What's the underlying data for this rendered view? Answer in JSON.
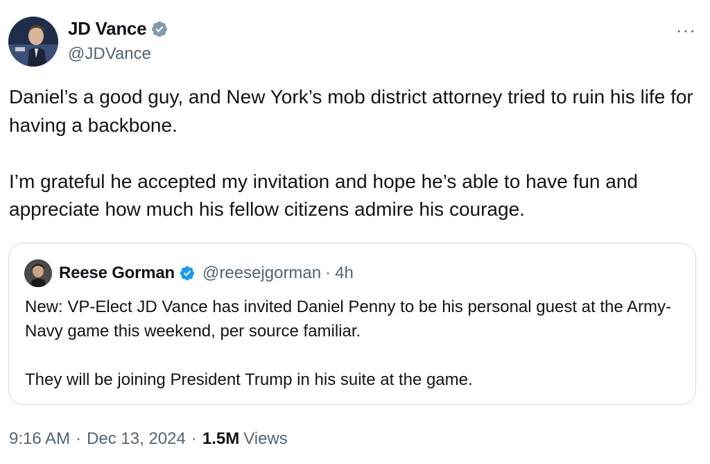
{
  "author": {
    "name": "JD Vance",
    "handle": "@JDVance"
  },
  "more_label": "···",
  "tweet": {
    "text": "Daniel’s a good guy, and New York’s mob district attorney tried to ruin his life for having a backbone.\n\nI’m grateful he accepted my invitation and hope he’s able to have fun and appreciate how much his fellow citizens admire his courage."
  },
  "quote": {
    "name": "Reese Gorman",
    "handle": "@reesejgorman",
    "dot": "·",
    "time": "4h",
    "text": "New: VP-Elect JD Vance has invited Daniel Penny to be his personal guest at the Army-Navy game this weekend, per source familiar.\n\nThey will be joining President Trump in his suite at the game."
  },
  "meta": {
    "time": "9:16 AM",
    "sep": "·",
    "date": "Dec 13, 2024",
    "views_count": "1.5M",
    "views_label": "Views"
  },
  "colors": {
    "badge_gray": "#829aab",
    "badge_blue": "#1d9bf0",
    "secondary_text": "#536471",
    "border": "#cfd9de"
  },
  "icons": {
    "author_badge": "verified-gray-badge-icon",
    "quote_badge": "verified-blue-badge-icon",
    "more": "more-options-icon"
  }
}
